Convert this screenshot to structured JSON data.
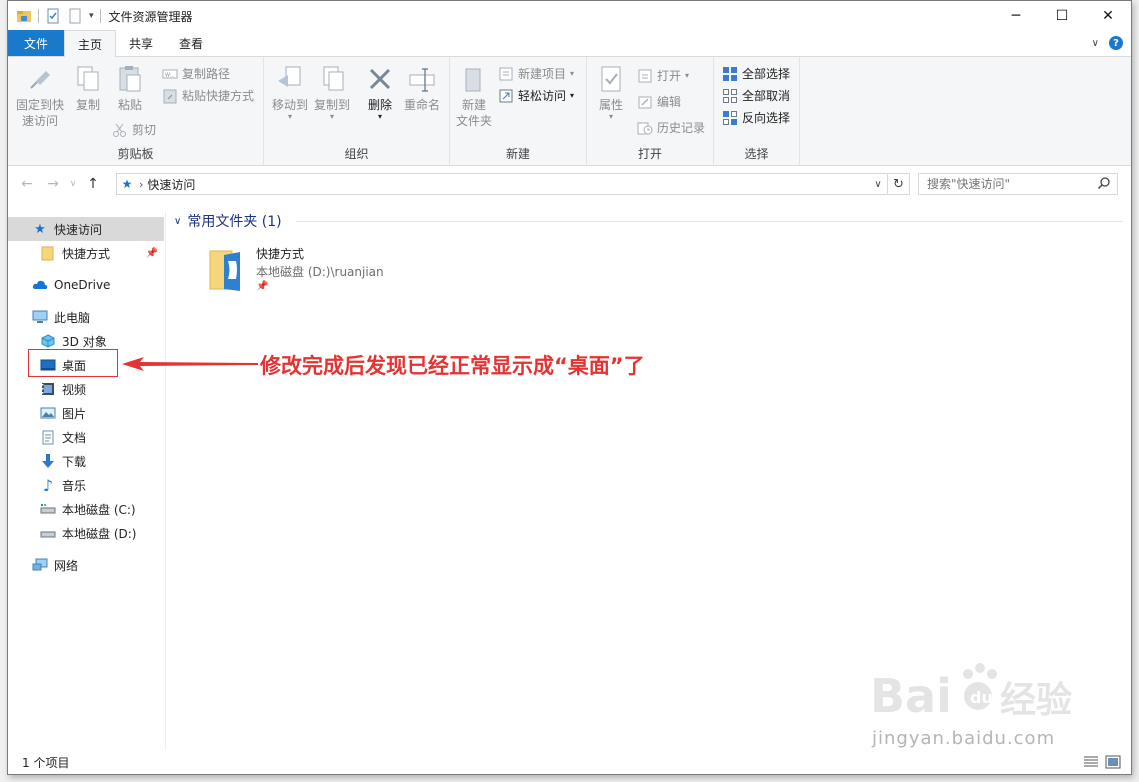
{
  "window": {
    "title": "文件资源管理器",
    "controls": {
      "minimize": "─",
      "maximize": "☐",
      "close": "✕"
    }
  },
  "ribbon_tabs": [
    "文件",
    "主页",
    "共享",
    "查看"
  ],
  "ribbon": {
    "clipboard": {
      "label": "剪贴板",
      "pin_quick_access": "固定到快\n速访问",
      "pin_line1": "固定到快",
      "pin_line2": "速访问",
      "copy": "复制",
      "paste": "粘贴",
      "copy_path": "复制路径",
      "paste_shortcut": "粘贴快捷方式",
      "cut": "剪切"
    },
    "organize": {
      "label": "组织",
      "move_to": "移动到",
      "copy_to": "复制到",
      "delete": "删除",
      "rename": "重命名"
    },
    "new": {
      "label": "新建",
      "new_folder_line1": "新建",
      "new_folder_line2": "文件夹",
      "new_item": "新建项目",
      "easy_access": "轻松访问"
    },
    "open": {
      "label": "打开",
      "properties": "属性",
      "open": "打开",
      "edit": "编辑",
      "history": "历史记录"
    },
    "select": {
      "label": "选择",
      "select_all": "全部选择",
      "select_none": "全部取消",
      "invert": "反向选择"
    }
  },
  "address": {
    "breadcrumb": "快速访问",
    "search_placeholder": "搜索\"快速访问\""
  },
  "nav": {
    "items": [
      {
        "label": "快速访问",
        "icon": "star-icon"
      },
      {
        "label": "快捷方式",
        "icon": "folder-icon"
      },
      {
        "label": "OneDrive",
        "icon": "cloud-icon"
      },
      {
        "label": "此电脑",
        "icon": "computer-icon"
      },
      {
        "label": "3D 对象",
        "icon": "cube-icon"
      },
      {
        "label": "桌面",
        "icon": "desktop-icon"
      },
      {
        "label": "视频",
        "icon": "video-icon"
      },
      {
        "label": "图片",
        "icon": "picture-icon"
      },
      {
        "label": "文档",
        "icon": "document-icon"
      },
      {
        "label": "下载",
        "icon": "download-icon"
      },
      {
        "label": "音乐",
        "icon": "music-icon"
      },
      {
        "label": "本地磁盘 (C:)",
        "icon": "drive-icon"
      },
      {
        "label": "本地磁盘 (D:)",
        "icon": "drive-icon"
      },
      {
        "label": "网络",
        "icon": "network-icon"
      }
    ]
  },
  "content": {
    "group_header": "常用文件夹 (1)",
    "items": [
      {
        "name": "快捷方式",
        "path": "本地磁盘 (D:)\\ruanjian"
      }
    ]
  },
  "status": {
    "count": "1 个项目"
  },
  "annotation": {
    "text": "修改完成后发现已经正常显示成“桌面”了"
  },
  "watermark": {
    "logo": "Bai du 经验",
    "url": "jingyan.baidu.com"
  },
  "colors": {
    "accent": "#1979ca",
    "annotation": "#e53333",
    "group_header": "#1e3287"
  }
}
